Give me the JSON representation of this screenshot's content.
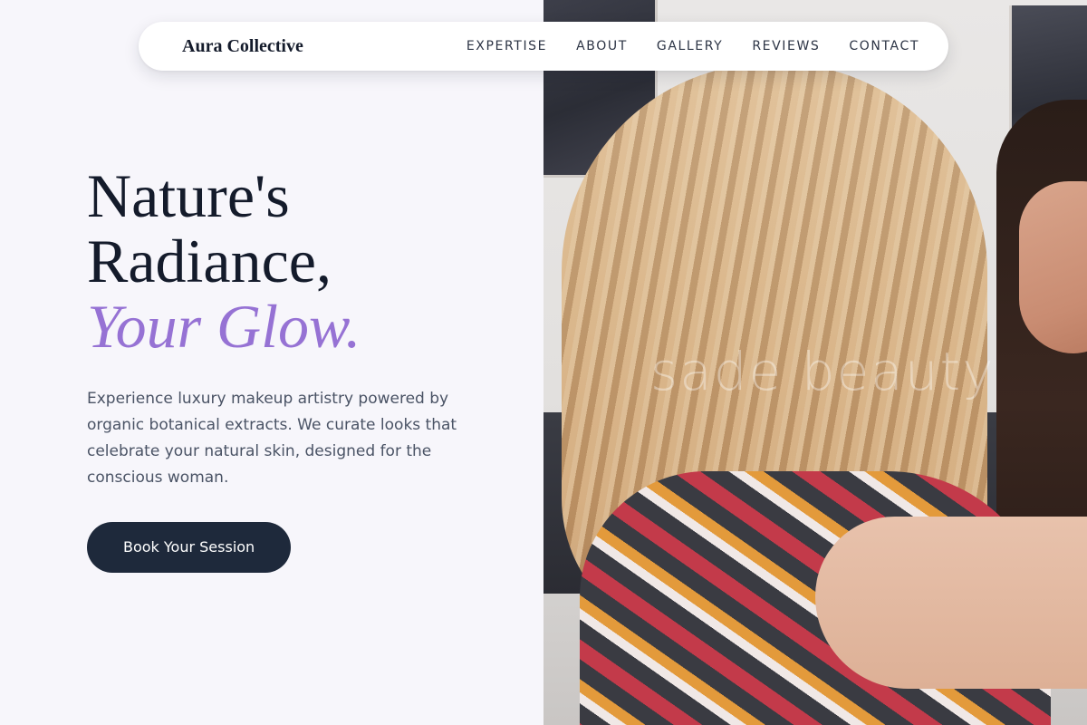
{
  "nav": {
    "brand": "Aura Collective",
    "links": [
      "EXPERTISE",
      "ABOUT",
      "GALLERY",
      "REVIEWS",
      "CONTACT"
    ]
  },
  "hero": {
    "headline_line1": "Nature's",
    "headline_line2": "Radiance,",
    "headline_accent": "Your Glow.",
    "description": "Experience luxury makeup artistry powered by organic botanical extracts. We curate looks that celebrate your natural skin, designed for the conscious woman.",
    "cta_label": "Book Your Session"
  },
  "photo": {
    "watermark": "sade beauty"
  },
  "colors": {
    "background": "#f7f6fb",
    "accent": "#9672d4",
    "button": "#1e293b",
    "heading": "#141b2b"
  }
}
